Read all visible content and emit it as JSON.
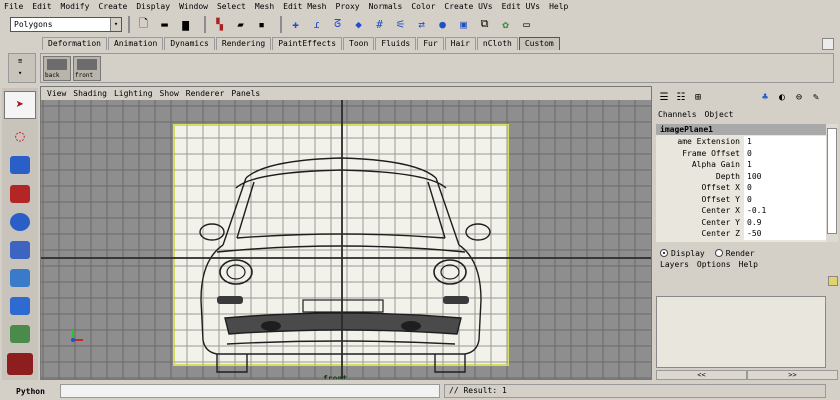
{
  "menubar": [
    "File",
    "Edit",
    "Modify",
    "Create",
    "Display",
    "Window",
    "Select",
    "Mesh",
    "Edit Mesh",
    "Proxy",
    "Normals",
    "Color",
    "Create UVs",
    "Edit UVs",
    "Help"
  ],
  "status_line": {
    "menu_set": "Polygons"
  },
  "shelf": {
    "tabs": [
      "Deformation",
      "Animation",
      "Dynamics",
      "Rendering",
      "PaintEffects",
      "Toon",
      "Fluids",
      "Fur",
      "Hair",
      "nCloth",
      "Custom"
    ],
    "active_tab": "Custom",
    "buttons": [
      "back",
      "front"
    ]
  },
  "viewport": {
    "menu": [
      "View",
      "Shading",
      "Lighting",
      "Show",
      "Renderer",
      "Panels"
    ],
    "camera": "front"
  },
  "channel_box": {
    "tabs": [
      "Channels",
      "Object"
    ],
    "object_name": "imagePlane1",
    "channels": [
      {
        "name": "ame Extension",
        "value": "1"
      },
      {
        "name": "Frame Offset",
        "value": "0"
      },
      {
        "name": "Alpha Gain",
        "value": "1"
      },
      {
        "name": "Depth",
        "value": "100"
      },
      {
        "name": "Offset X",
        "value": "0"
      },
      {
        "name": "Offset Y",
        "value": "0"
      },
      {
        "name": "Center X",
        "value": "-0.1"
      },
      {
        "name": "Center Y",
        "value": "0.9"
      },
      {
        "name": "Center Z",
        "value": "-50"
      }
    ]
  },
  "layer_editor": {
    "display_label": "Display",
    "render_label": "Render",
    "menu": [
      "Layers",
      "Options",
      "Help"
    ]
  },
  "command_line": {
    "label": "Python",
    "result": "// Result: 1"
  },
  "colors": {
    "grid": "#6b6b6b",
    "viewport_bg": "#8e8e8e",
    "image_plane": "#f2f2ea",
    "camera_label": "#143c14"
  }
}
